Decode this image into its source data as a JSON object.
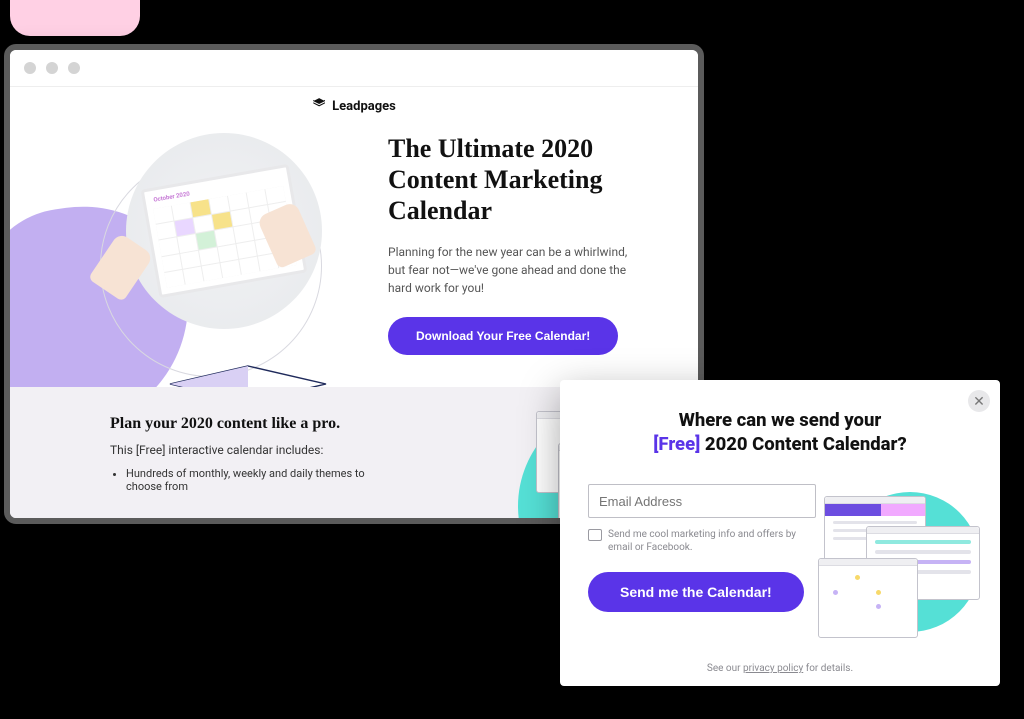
{
  "brand": {
    "name": "Leadpages"
  },
  "hero": {
    "title": "The Ultimate 2020 Content Marketing Calendar",
    "subtitle": "Planning for the new year can be a whirlwind, but fear not—we've gone ahead and done the hard work for you!",
    "cta_label": "Download Your Free Calendar!",
    "tablet_month": "October 2020"
  },
  "lower": {
    "title": "Plan your 2020 content like a pro.",
    "subtitle": "This [Free] interactive calendar includes:",
    "bullet_1": "Hundreds of monthly, weekly and daily themes to choose from"
  },
  "popup": {
    "title_pre": "Where can we send your",
    "title_accent": "[Free]",
    "title_post": "2020 Content Calendar?",
    "email_placeholder": "Email Address",
    "optin_text": "Send me cool marketing info and offers by email or Facebook.",
    "submit_label": "Send me the Calendar!",
    "privacy_pre": "See our ",
    "privacy_link": "privacy policy",
    "privacy_post": " for details."
  }
}
